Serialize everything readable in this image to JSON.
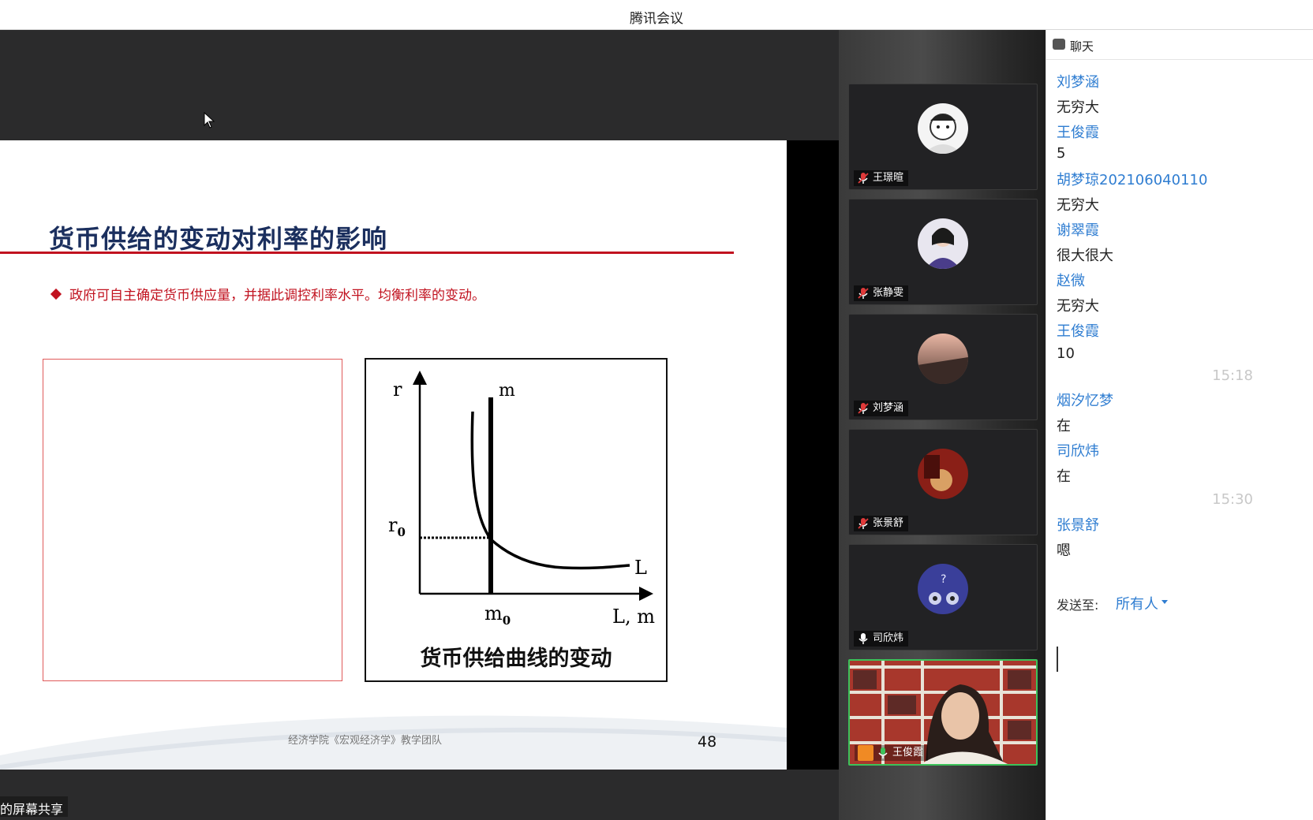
{
  "window": {
    "title": "腾讯会议"
  },
  "slide": {
    "title": "货币供给的变动对利率的影响",
    "bullet": "政府可自主确定货币供应量，并据此调控利率水平。均衡利率的变动。",
    "graph": {
      "y_axis_label": "r",
      "x_axis_label": "L, m",
      "supply_label": "m",
      "demand_label": "L",
      "r0_main": "r",
      "r0_sub": "0",
      "m0_main": "m",
      "m0_sub": "0",
      "caption": "货币供给曲线的变动"
    },
    "footer": "经济学院《宏观经济学》教学团队",
    "page_number": "48"
  },
  "share_label": "的屏幕共享",
  "participants": [
    {
      "name": "王璟暄",
      "muted": true,
      "icon": "muted-mic-icon"
    },
    {
      "name": "张静雯",
      "muted": true,
      "icon": "muted-mic-icon"
    },
    {
      "name": "刘梦涵",
      "muted": true,
      "icon": "muted-mic-icon"
    },
    {
      "name": "张景舒",
      "muted": true,
      "icon": "muted-mic-icon"
    },
    {
      "name": "司欣炜",
      "muted": false,
      "icon": "mic-icon"
    },
    {
      "name": "王俊霞",
      "muted": false,
      "icon": "mic-icon",
      "host": true,
      "video_on": true
    }
  ],
  "chat": {
    "header": "聊天",
    "messages": [
      {
        "sender": "刘梦涵",
        "text": "无穷大"
      },
      {
        "sender": "王俊霞",
        "text": "5"
      },
      {
        "sender": "胡梦琼202106040110",
        "text": "无穷大"
      },
      {
        "sender": "谢翠霞",
        "text": "很大很大"
      },
      {
        "sender": "赵微",
        "text": "无穷大"
      },
      {
        "sender": "王俊霞",
        "text": "10"
      },
      {
        "time": "15:18"
      },
      {
        "sender": "烟汐忆梦",
        "text": "在"
      },
      {
        "sender": "司欣炜",
        "text": "在"
      },
      {
        "time": "15:30"
      },
      {
        "sender": "张景舒",
        "text": "嗯"
      }
    ],
    "send_to_label": "发送至:",
    "send_to_value": "所有人"
  },
  "colors": {
    "accent_blue": "#2f7dd1",
    "slide_red": "#c1121f",
    "slide_title": "#1b2f5e",
    "active_speaker_border": "#3cc25a"
  }
}
